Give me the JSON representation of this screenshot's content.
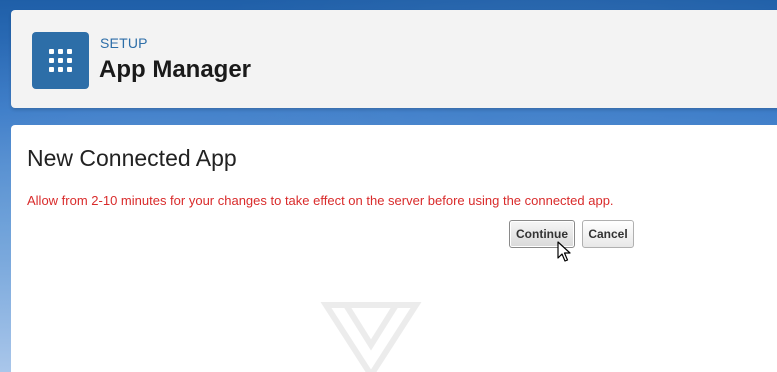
{
  "header": {
    "section_label": "SETUP",
    "page_title": "App Manager",
    "icon": "app-grid-icon"
  },
  "content": {
    "title": "New Connected App",
    "notice": "Allow from 2-10 minutes for your changes to take effect on the server before using the connected app.",
    "continue_label": "Continue",
    "cancel_label": "Cancel"
  },
  "colors": {
    "brand_blue": "#2d6ea8",
    "notice_red": "#d92b2b"
  }
}
